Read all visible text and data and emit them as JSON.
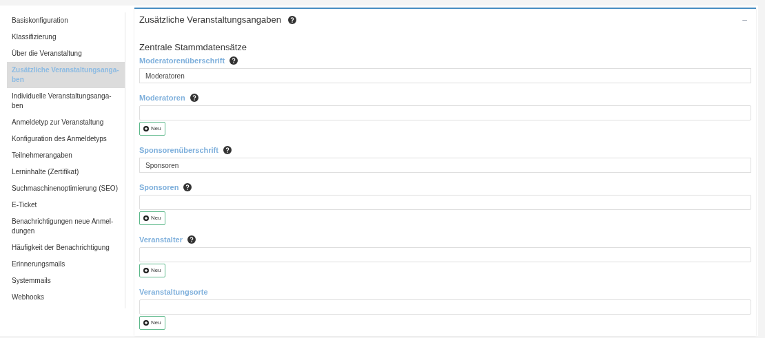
{
  "sidebar": {
    "items": [
      {
        "lines": [
          "Basiskonfiguration"
        ],
        "selected": false
      },
      {
        "lines": [
          "Klassifizierung"
        ],
        "selected": false
      },
      {
        "lines": [
          "Über die Veranstaltung"
        ],
        "selected": false
      },
      {
        "lines": [
          "Zusätzliche Veranstaltungsanga-",
          "ben"
        ],
        "selected": true
      },
      {
        "lines": [
          "Individuelle Veranstaltungsanga-",
          "ben"
        ],
        "selected": false
      },
      {
        "lines": [
          "Anmeldetyp zur Veranstaltung"
        ],
        "selected": false
      },
      {
        "lines": [
          "Konfiguration des Anmeldetyps"
        ],
        "selected": false
      },
      {
        "lines": [
          "Teilnehmerangaben"
        ],
        "selected": false
      },
      {
        "lines": [
          "Lerninhalte (Zertifikat)"
        ],
        "selected": false
      },
      {
        "lines": [
          "Suchmaschinenoptimierung (SEO)"
        ],
        "selected": false
      },
      {
        "lines": [
          "E-Ticket"
        ],
        "selected": false
      },
      {
        "lines": [
          "Benachrichtigungen neue Anmel-",
          "dungen"
        ],
        "selected": false
      },
      {
        "lines": [
          "Häufigkeit der Benachrichtigung"
        ],
        "selected": false
      },
      {
        "lines": [
          "Erinnerungsmails"
        ],
        "selected": false
      },
      {
        "lines": [
          "Systemmails"
        ],
        "selected": false
      },
      {
        "lines": [
          "Webhooks"
        ],
        "selected": false
      }
    ]
  },
  "panel": {
    "title": "Zusätzliche Veranstaltungsangaben",
    "collapse": "–",
    "section": "Zentrale Stammdatensätze",
    "fields": [
      {
        "kind": "text",
        "label": "Moderatorenüberschrift",
        "help": true,
        "value": "Moderatoren"
      },
      {
        "kind": "list",
        "label": "Moderatoren",
        "help": true,
        "button": "Neu"
      },
      {
        "kind": "text",
        "label": "Sponsorenüberschrift",
        "help": true,
        "value": "Sponsoren"
      },
      {
        "kind": "list",
        "label": "Sponsoren",
        "help": true,
        "button": "Neu"
      },
      {
        "kind": "list",
        "label": "Veranstalter",
        "help": true,
        "button": "Neu"
      },
      {
        "kind": "list",
        "label": "Veranstaltungsorte",
        "help": false,
        "button": "Neu"
      }
    ]
  }
}
